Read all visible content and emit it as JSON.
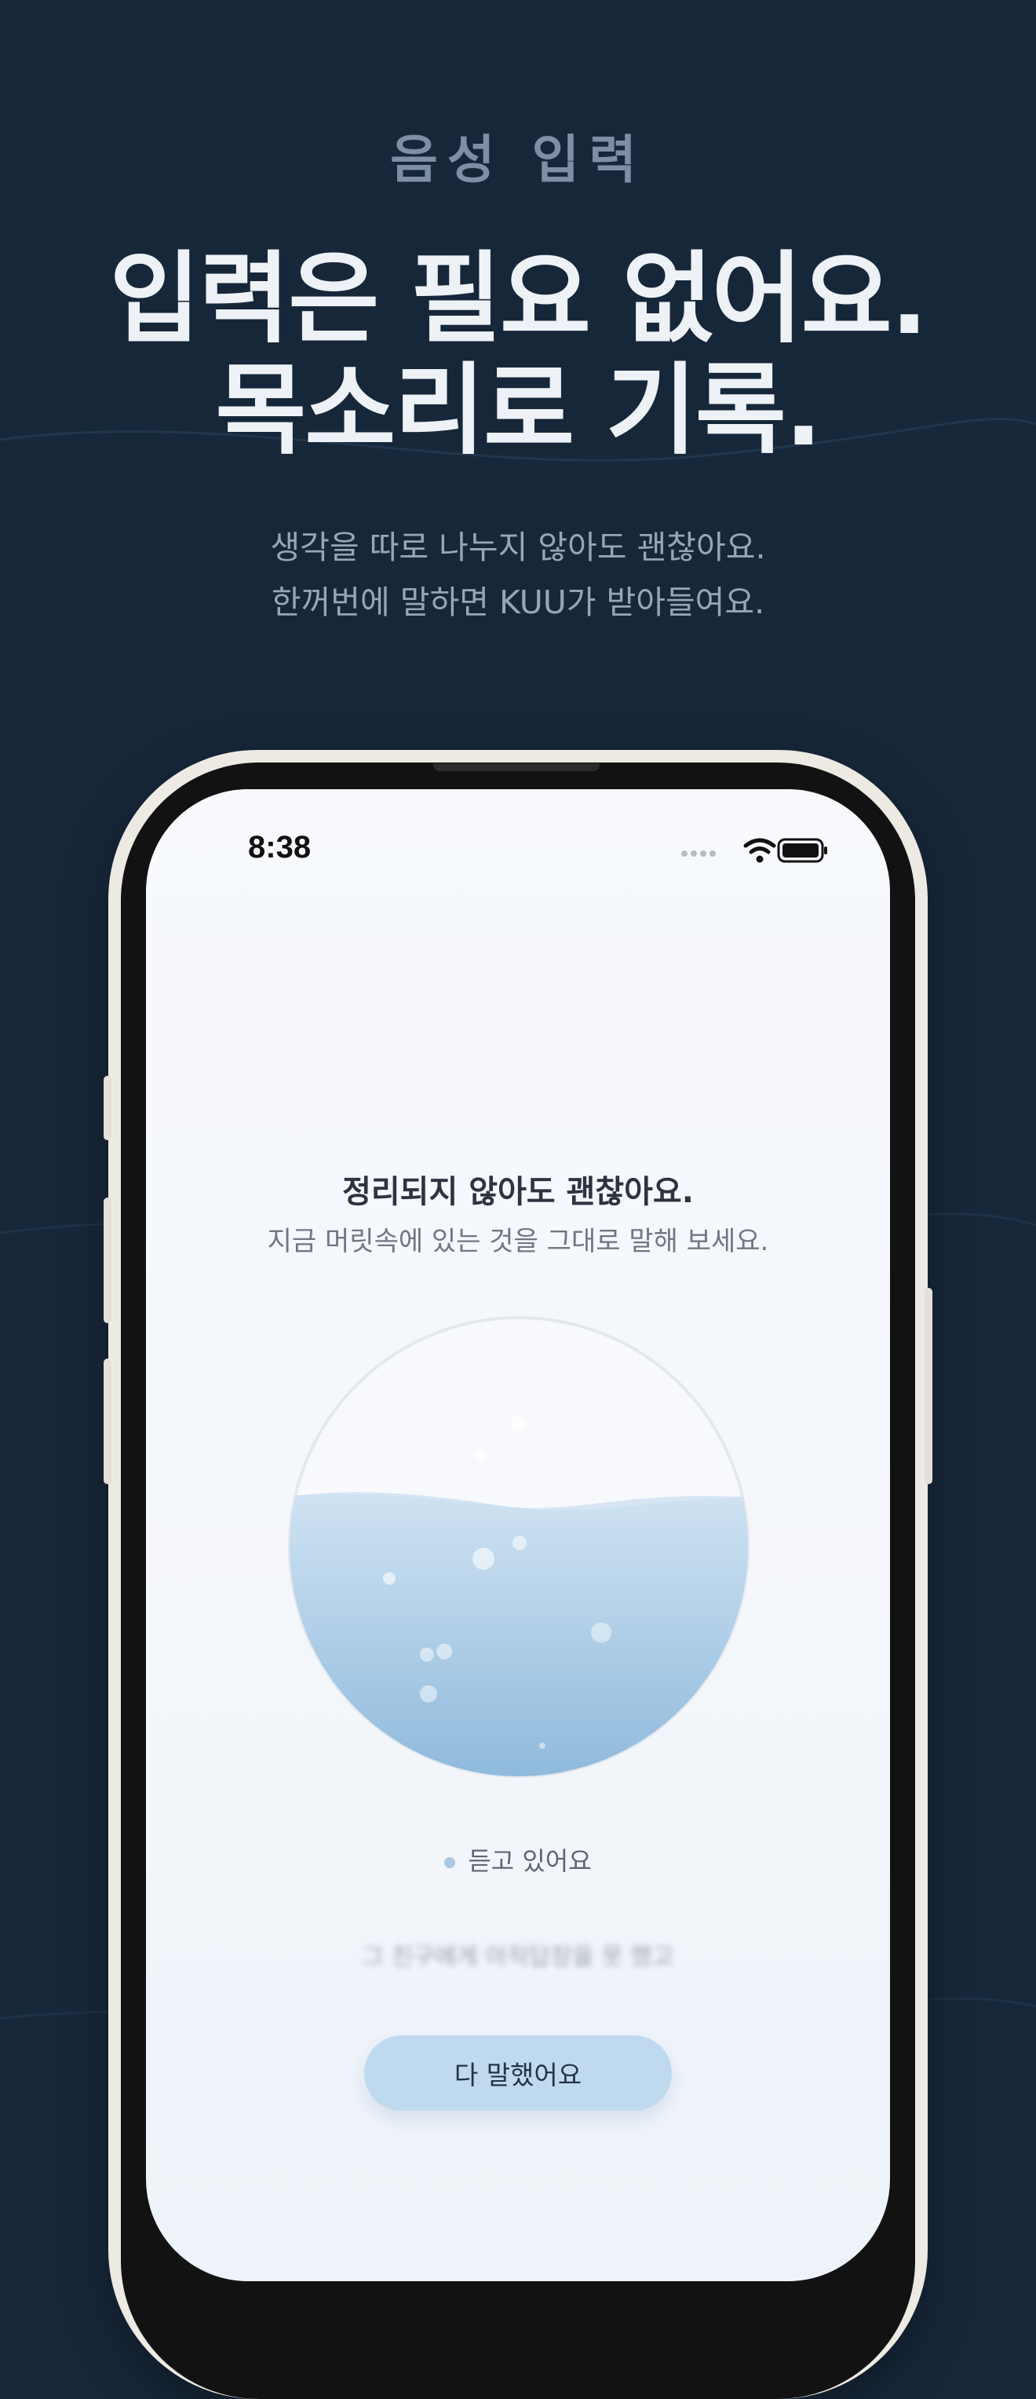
{
  "header": {
    "eyebrow": "음성 입력",
    "headline_line1": "입력은 필요 없어요.",
    "headline_line2": "목소리로 기록.",
    "subcopy_line1": "생각을 따로 나누지 않아도 괜찮아요.",
    "subcopy_line2": "한꺼번에 말하면 KUU가 받아들여요."
  },
  "status_bar": {
    "time": "8:38",
    "icons": [
      "signal-icon",
      "wifi-icon",
      "battery-icon"
    ]
  },
  "prompt": {
    "title": "정리되지 않아도 괜찮아요.",
    "subtitle": "지금 머릿속에 있는 것을 그대로 말해 보세요."
  },
  "recorder": {
    "status": "듣고 있어요",
    "transcript_preview": "그 친구에게 아직답장을 못 했고",
    "done_label": "다 말했어요"
  },
  "colors": {
    "background": "#17273a",
    "screen": "#f5f8fc",
    "water": "#a9cbe6",
    "button": "#bfdaee",
    "headline": "#eef2f7"
  }
}
